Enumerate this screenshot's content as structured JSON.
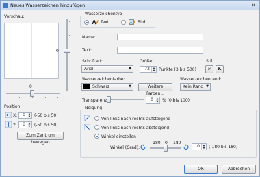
{
  "window": {
    "title": "Neues Wasserzeichen hinzufügen"
  },
  "preview": {
    "label": "Vorschau:",
    "vertical_value": "0",
    "horizontal_value": "0"
  },
  "position": {
    "label": "Position",
    "x_label": "X:",
    "x_value": "0",
    "x_range": "(-50 bis 50)",
    "y_label": "Y:",
    "y_value": "0",
    "y_range": "(-50 bis 50)",
    "center_button": "Zum Zentrum bewegen"
  },
  "type": {
    "label": "Wasserzeichentyp",
    "text_option": "Text",
    "image_option": "Bild",
    "selected": "Text"
  },
  "fields": {
    "name_label": "Name:",
    "name_value": "",
    "text_label": "Text:",
    "text_value": ""
  },
  "font": {
    "font_label": "Schriftart:",
    "font_value": "Arial",
    "size_label": "Größe:",
    "size_value": "72",
    "size_unit": "Punkte (3 bis 500)",
    "style_label": "Stil:",
    "bold": "F",
    "italic": "K"
  },
  "color": {
    "color_label": "Wasserzeichenfarbe:",
    "color_value": "Schwarz",
    "color_hex": "#000000",
    "more_colors_button": "Weitere Farben...",
    "border_label": "Wasserzeichenrand:",
    "border_value": "Kein Rand"
  },
  "transparency": {
    "label": "Transparenz:",
    "value": "0",
    "unit": "% (0 bis 100)"
  },
  "tilt": {
    "label": "Neigung",
    "option_up": "Von links nach rechts aufsteigend",
    "option_down": "Von links nach rechts absteigend",
    "option_custom": "Winkel einstellen",
    "selected": "Winkel einstellen",
    "angle_label": "Winkel (Grad):",
    "scale_min": "-180",
    "scale_mid": "0",
    "scale_max": "180",
    "angle_value": "0",
    "angle_range": "(-180 bis 180)"
  },
  "buttons": {
    "ok": "OK",
    "cancel": "Abbrechen"
  }
}
